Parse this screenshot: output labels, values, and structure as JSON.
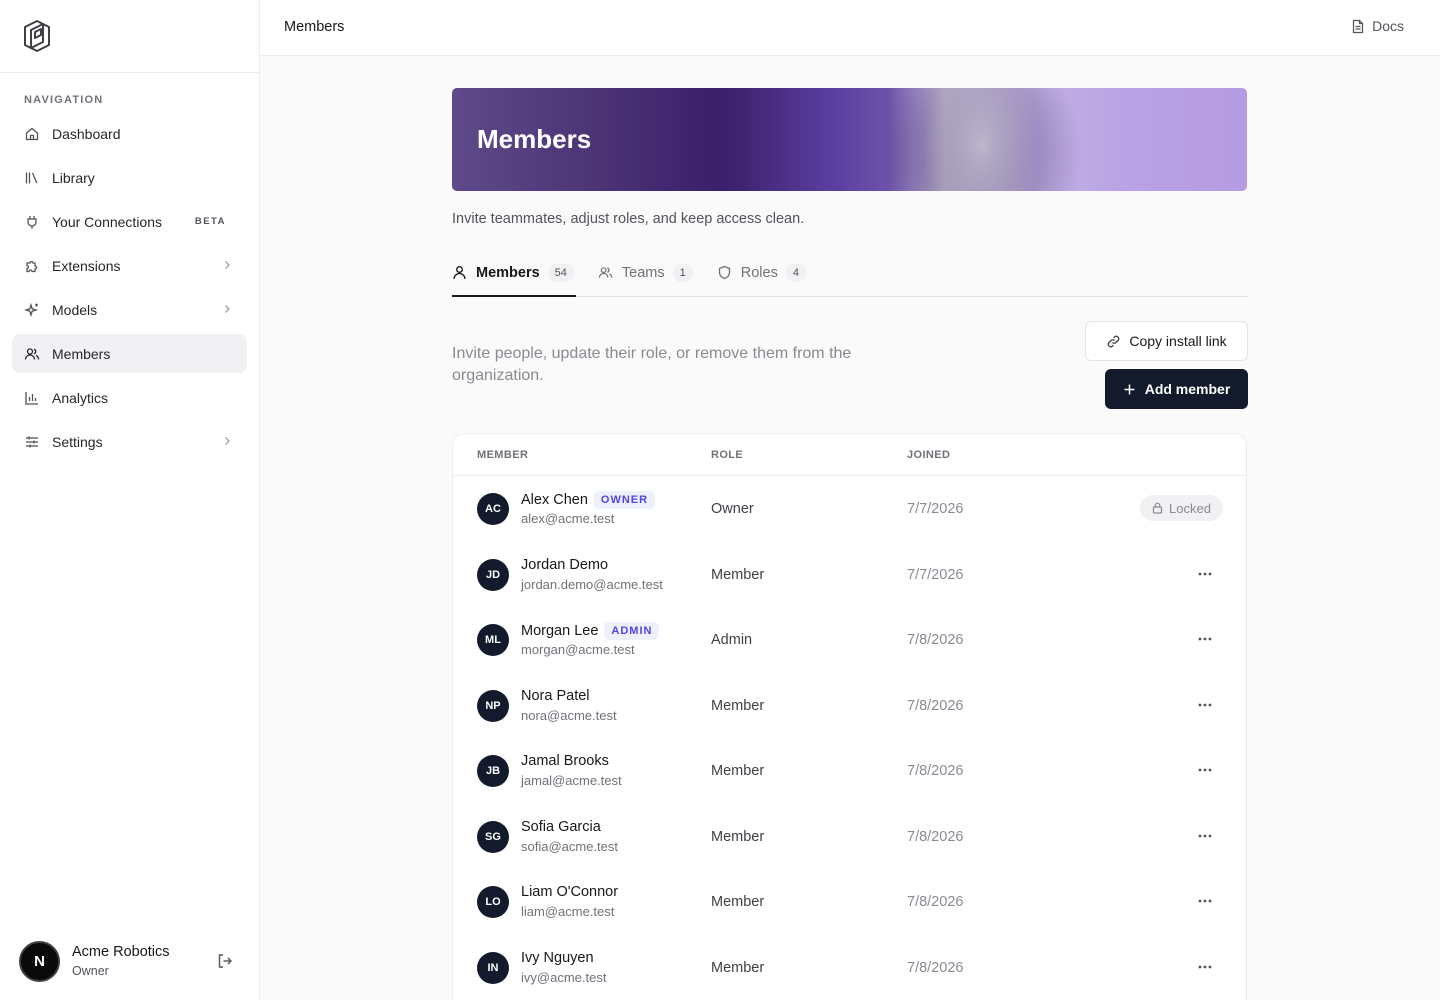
{
  "sidebar": {
    "nav_heading": "NAVIGATION",
    "items": [
      {
        "label": "Dashboard",
        "icon": "home-icon"
      },
      {
        "label": "Library",
        "icon": "library-icon"
      },
      {
        "label": "Your Connections",
        "icon": "plug-icon",
        "tag": "BETA"
      },
      {
        "label": "Extensions",
        "icon": "puzzle-icon",
        "has_chevron": true
      },
      {
        "label": "Models",
        "icon": "sparkles-icon",
        "has_chevron": true
      },
      {
        "label": "Members",
        "icon": "users-icon",
        "active": true
      },
      {
        "label": "Analytics",
        "icon": "bar-chart-icon"
      },
      {
        "label": "Settings",
        "icon": "sliders-icon",
        "has_chevron": true
      }
    ],
    "account": {
      "initial": "N",
      "name": "Acme Robotics",
      "role": "Owner"
    }
  },
  "topbar": {
    "breadcrumb": "Members",
    "docs_label": "Docs"
  },
  "banner": {
    "title": "Members"
  },
  "subtitle": "Invite teammates, adjust roles, and keep access clean.",
  "tabs": [
    {
      "label": "Members",
      "count": "54",
      "active": true
    },
    {
      "label": "Teams",
      "count": "1"
    },
    {
      "label": "Roles",
      "count": "4"
    }
  ],
  "toolbar": {
    "description": "Invite people, update their role, or remove them from the organization.",
    "copy_label": "Copy install link",
    "add_label": "Add member"
  },
  "table": {
    "headers": {
      "member": "MEMBER",
      "role": "ROLE",
      "joined": "JOINED"
    },
    "locked_label": "Locked",
    "rows": [
      {
        "initials": "AC",
        "name": "Alex Chen",
        "badge": "OWNER",
        "email": "alex@acme.test",
        "role": "Owner",
        "joined": "7/7/2026",
        "locked": true
      },
      {
        "initials": "JD",
        "name": "Jordan Demo",
        "badge": "",
        "email": "jordan.demo@acme.test",
        "role": "Member",
        "joined": "7/7/2026"
      },
      {
        "initials": "ML",
        "name": "Morgan Lee",
        "badge": "ADMIN",
        "email": "morgan@acme.test",
        "role": "Admin",
        "joined": "7/8/2026"
      },
      {
        "initials": "NP",
        "name": "Nora Patel",
        "badge": "",
        "email": "nora@acme.test",
        "role": "Member",
        "joined": "7/8/2026"
      },
      {
        "initials": "JB",
        "name": "Jamal Brooks",
        "badge": "",
        "email": "jamal@acme.test",
        "role": "Member",
        "joined": "7/8/2026"
      },
      {
        "initials": "SG",
        "name": "Sofia Garcia",
        "badge": "",
        "email": "sofia@acme.test",
        "role": "Member",
        "joined": "7/8/2026"
      },
      {
        "initials": "LO",
        "name": "Liam O'Connor",
        "badge": "",
        "email": "liam@acme.test",
        "role": "Member",
        "joined": "7/8/2026"
      },
      {
        "initials": "IN",
        "name": "Ivy Nguyen",
        "badge": "",
        "email": "ivy@acme.test",
        "role": "Member",
        "joined": "7/8/2026"
      }
    ]
  },
  "colors": {
    "primary_button": "#131a2b",
    "badge_text": "#4f46e5",
    "active_nav_bg": "#f1f1f4"
  }
}
